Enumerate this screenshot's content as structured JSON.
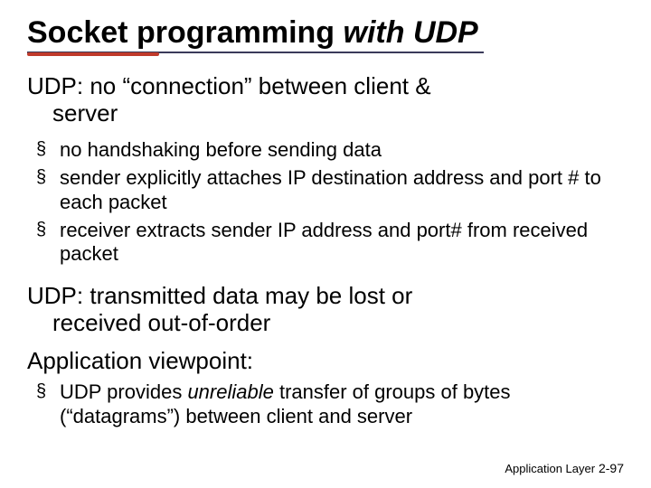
{
  "title": {
    "part1": "Socket programming",
    "part2": " with UDP"
  },
  "lead1": {
    "line1": "UDP: no “connection” between client &",
    "line2": "server"
  },
  "bullets_a": {
    "b1": "no handshaking before sending data",
    "b2": "sender explicitly attaches IP destination address and port # to each packet",
    "b3": "receiver extracts sender IP address and port# from received packet"
  },
  "lead2": {
    "line1": "UDP: transmitted data may be lost or",
    "line2": "received out-of-order"
  },
  "lead3": "Application viewpoint:",
  "bullets_b": {
    "b1_pre": "UDP provides ",
    "b1_em": "unreliable",
    "b1_post": " transfer  of groups of bytes (“datagrams”)  between client and server"
  },
  "footer": {
    "label": "Application Layer",
    "page": "2-97"
  }
}
